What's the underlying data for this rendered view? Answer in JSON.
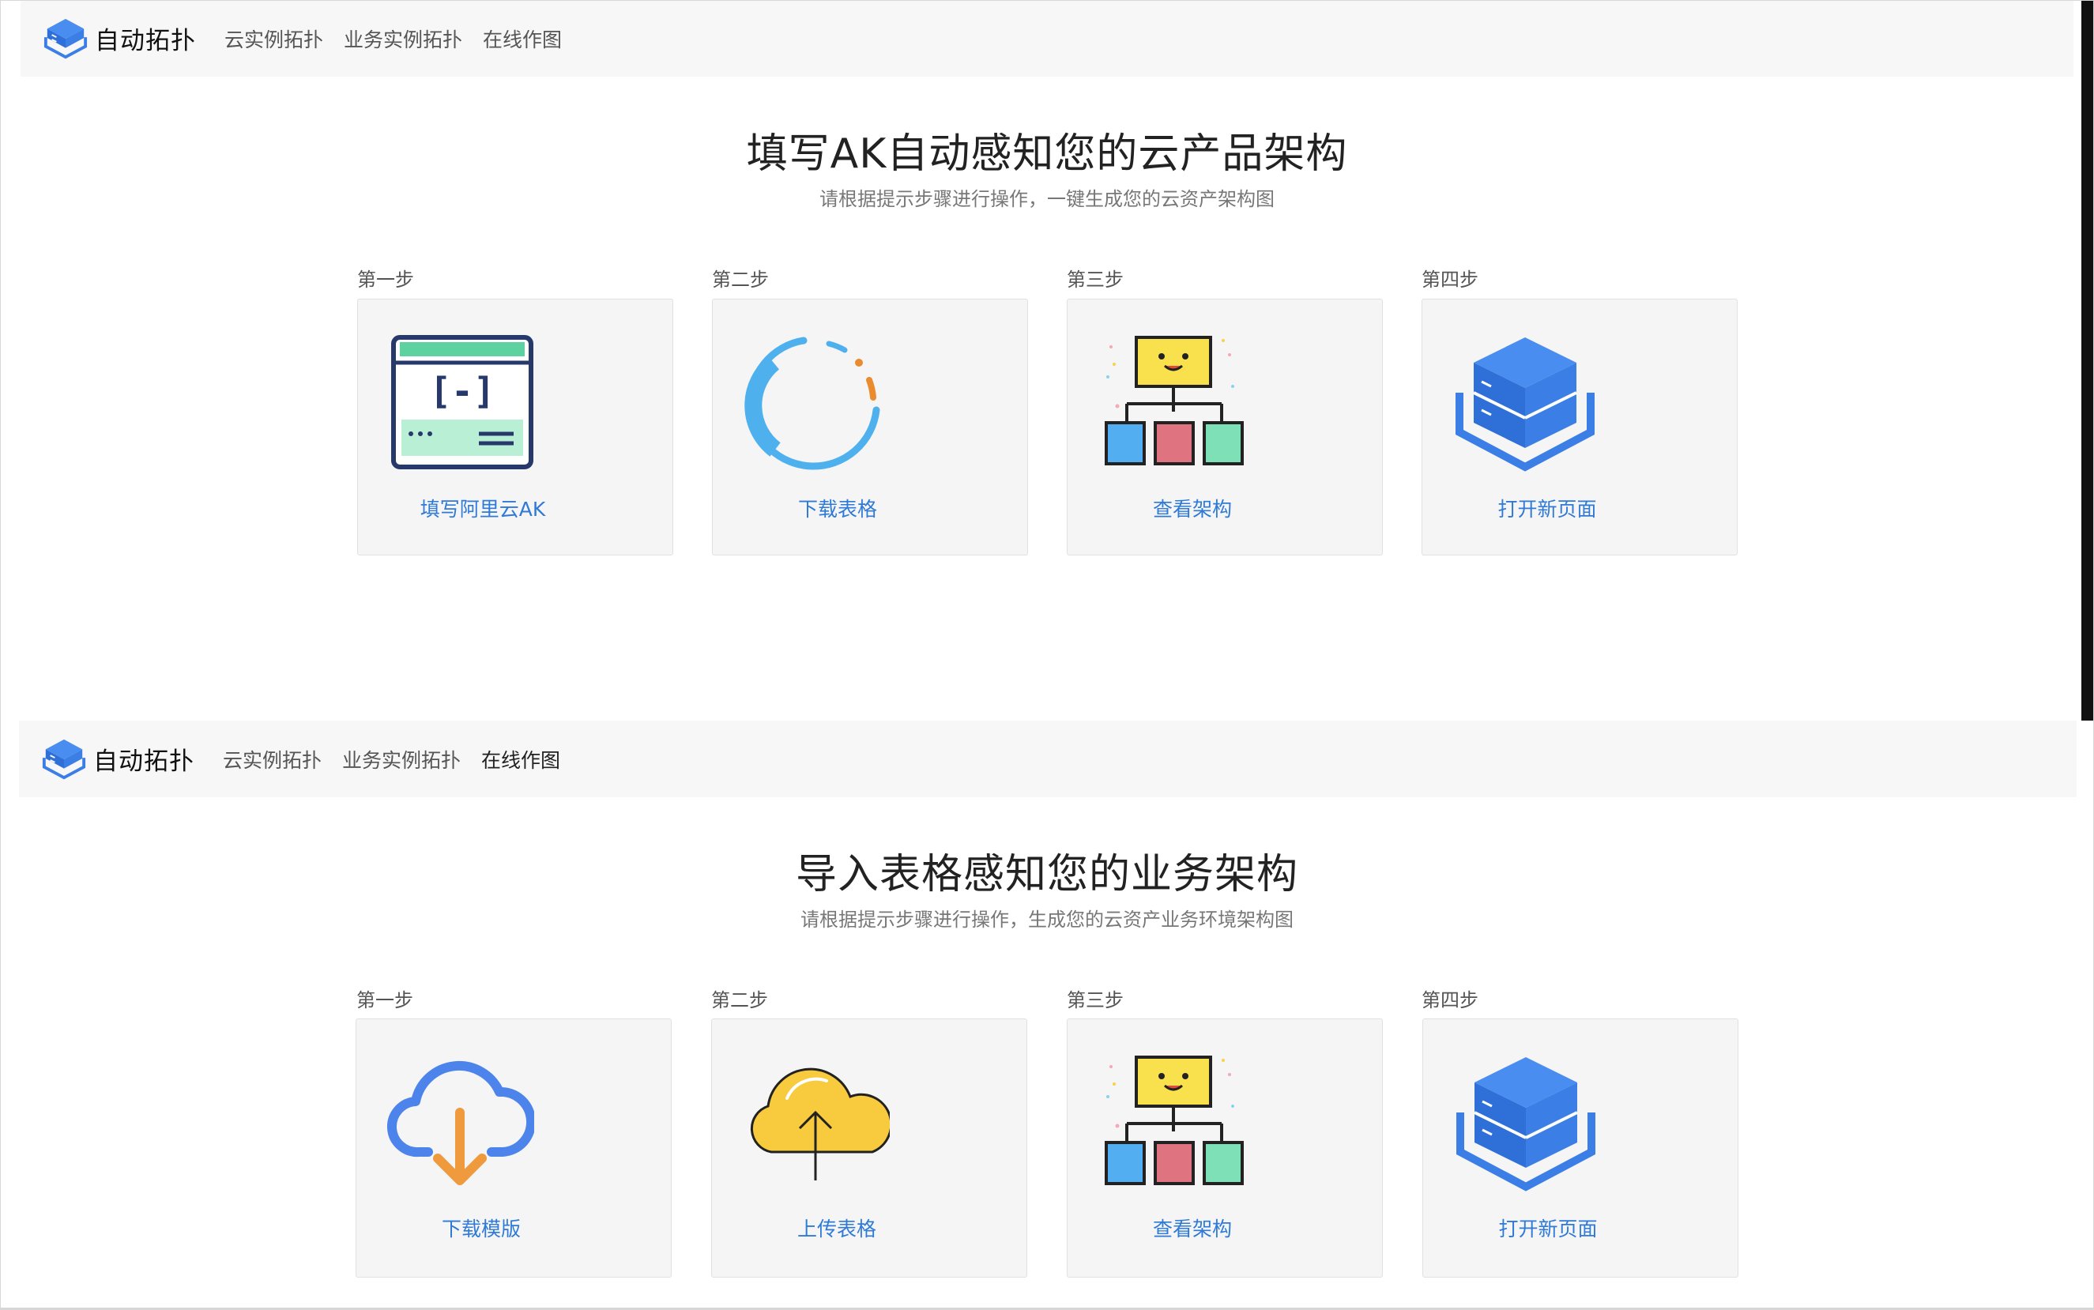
{
  "top": {
    "nav": {
      "brand": "自动拓扑",
      "links": [
        "云实例拓扑",
        "业务实例拓扑",
        "在线作图"
      ]
    },
    "title": "填写AK自动感知您的云产品架构",
    "subtitle": "请根据提示步骤进行操作，一键生成您的云资产架构图",
    "steps": [
      {
        "label": "第一步",
        "action": "填写阿里云AK",
        "icon": "browser-code-icon"
      },
      {
        "label": "第二步",
        "action": "下载表格",
        "icon": "loading-ring-icon"
      },
      {
        "label": "第三步",
        "action": "查看架构",
        "icon": "org-chart-icon"
      },
      {
        "label": "第四步",
        "action": "打开新页面",
        "icon": "server-stack-icon"
      }
    ]
  },
  "bottom": {
    "nav": {
      "brand": "自动拓扑",
      "links": [
        "云实例拓扑",
        "业务实例拓扑",
        "在线作图"
      ]
    },
    "title": "导入表格感知您的业务架构",
    "subtitle": "请根据提示步骤进行操作，生成您的云资产业务环境架构图",
    "steps": [
      {
        "label": "第一步",
        "action": "下载模版",
        "icon": "cloud-download-icon"
      },
      {
        "label": "第二步",
        "action": "上传表格",
        "icon": "cloud-upload-icon"
      },
      {
        "label": "第三步",
        "action": "查看架构",
        "icon": "org-chart-icon"
      },
      {
        "label": "第四步",
        "action": "打开新页面",
        "icon": "server-stack-icon"
      }
    ]
  },
  "colors": {
    "accent_link": "#2f7ad6",
    "nav_bg": "#f7f7f8",
    "card_bg": "#f5f5f6",
    "brand_blue": "#3f7fe8"
  }
}
